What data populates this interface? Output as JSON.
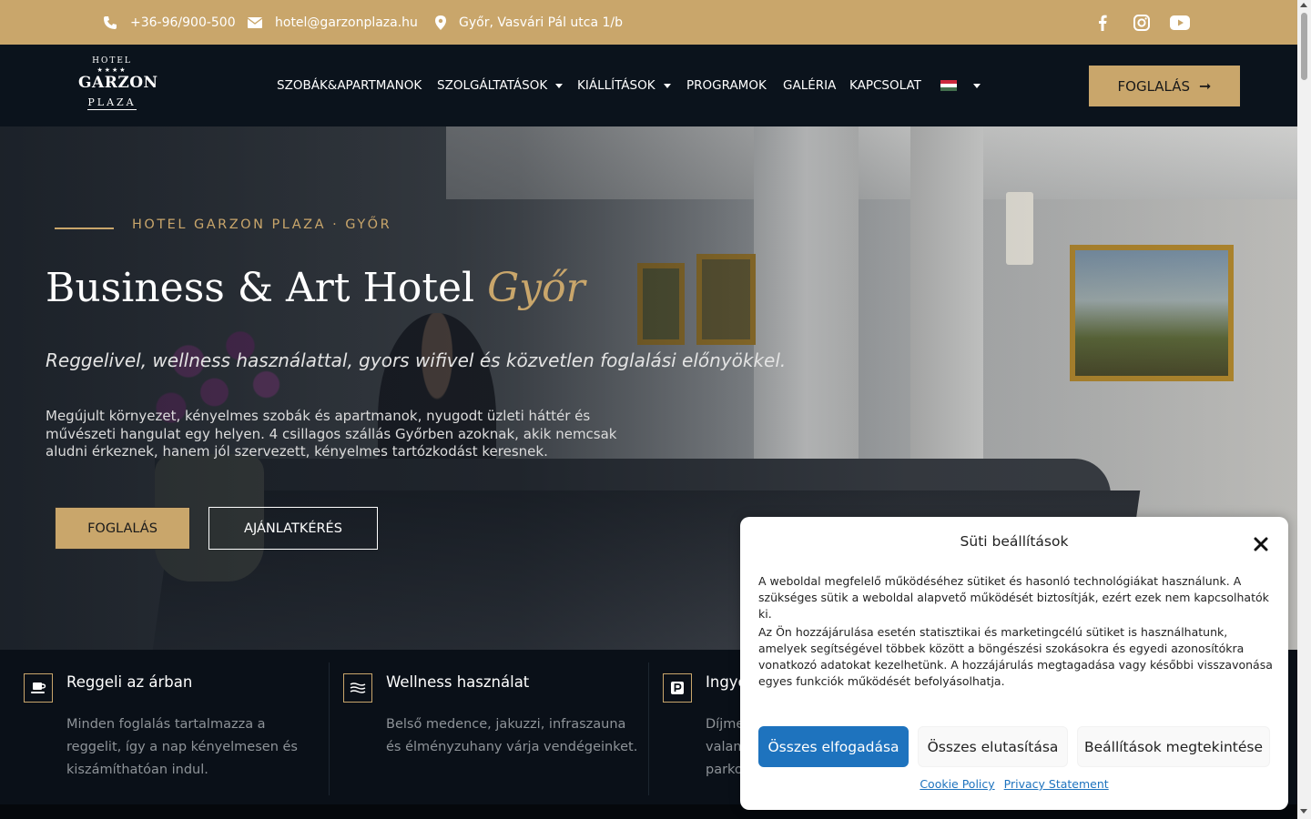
{
  "topbar": {
    "phone": "+36-96/900-500",
    "email": "hotel@garzonplaza.hu",
    "address": "Győr, Vasvári Pál utca 1/b",
    "icons": [
      "phone-icon",
      "envelope-icon",
      "map-marker-icon",
      "facebook-icon",
      "instagram-icon",
      "youtube-icon"
    ],
    "color": "#c9a66b"
  },
  "logo": {
    "line1": "HOTEL",
    "stars": "★★★★",
    "line2": "GARZON",
    "line3": "PLAZA"
  },
  "nav": {
    "items": [
      {
        "label": "SZOBÁK&APARTMANOK"
      },
      {
        "label": "SZOLGÁLTATÁSOK"
      },
      {
        "label": "KIÁLLÍTÁSOK"
      },
      {
        "label": "PROGRAMOK"
      },
      {
        "label": "GALÉRIA"
      },
      {
        "label": "KAPCSOLAT"
      }
    ],
    "language_flag": "hungary-flag-icon",
    "book_label": "FOGLALÁS",
    "book_arrow": "➞"
  },
  "hero": {
    "eyebrow": "HOTEL GARZON PLAZA · GYŐR",
    "title_main": "Business & Art Hotel ",
    "title_accent": "Győr",
    "subtitle": "Reggelivel, wellness használattal, gyors wifivel és közvetlen foglalási előnyökkel.",
    "text": "Megújult környezet, kényelmes szobák és apartmanok, nyugodt üzleti háttér és művészeti hangulat egy helyen. 4 csillagos szállás Győrben azoknak, akik nemcsak aludni érkeznek, hanem jól szervezett, kényelmes tartózkodást keresnek.",
    "btn_primary": "FOGLALÁS",
    "btn_secondary": "AJÁNLATKÉRÉS"
  },
  "features": [
    {
      "icon": "coffee-cup-icon",
      "title": "Reggeli az árban",
      "desc": "Minden foglalás tartalmazza a reggelit, így a nap kényelmesen és kiszámíthatóan indul."
    },
    {
      "icon": "waves-icon",
      "title": "Wellness használat",
      "desc": "Belső medence, jakuzzi, infraszauna és élményzuhany várja vendégeinket."
    },
    {
      "icon": "parking-icon",
      "title": "Ingye",
      "desc": "Díjme\nvalam\nparko"
    }
  ],
  "cookie": {
    "title": "Süti beállítások",
    "p1": "A weboldal megfelelő működéséhez sütiket és hasonló technológiákat használunk. A szükséges sütik a weboldal alapvető működését biztosítják, ezért ezek nem kapcsolhatók ki.",
    "p2": "Az Ön hozzájárulása esetén statisztikai és marketingcélú sütiket is használhatunk, amelyek segítségével többek között a böngészési szokásokra és egyedi azonosítókra vonatkozó adatokat kezelhetünk. A hozzájárulás megtagadása vagy későbbi visszavonása egyes funkciók működését befolyásolhatja.",
    "accept": "Összes elfogadása",
    "reject": "Összes elutasítása",
    "settings": "Beállítások megtekintése",
    "link1": "Cookie Policy",
    "link2": "Privacy Statement",
    "accent": "#1e73be"
  }
}
